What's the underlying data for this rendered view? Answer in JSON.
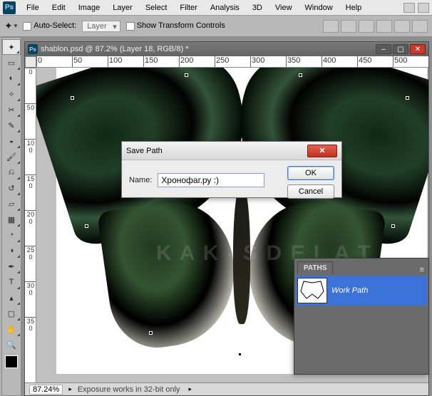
{
  "menu": {
    "items": [
      "File",
      "Edit",
      "Image",
      "Layer",
      "Select",
      "Filter",
      "Analysis",
      "3D",
      "View",
      "Window",
      "Help"
    ]
  },
  "options": {
    "auto_select_label": "Auto-Select:",
    "auto_select_value": "Layer",
    "show_transform_label": "Show Transform Controls"
  },
  "document": {
    "title": "shablon.psd @ 87.2% (Layer 18, RGB/8) *"
  },
  "ruler": {
    "h": [
      "0",
      "50",
      "100",
      "150",
      "200",
      "250",
      "300",
      "350",
      "400",
      "450",
      "500"
    ],
    "v": [
      "0",
      "5 0",
      "1 0 0",
      "1 5 0",
      "2 0 0",
      "2 5 0",
      "3 0 0",
      "3 5 0"
    ]
  },
  "dialog": {
    "title": "Save Path",
    "name_label": "Name:",
    "name_value": "Хронофаг.ру :)",
    "ok": "OK",
    "cancel": "Cancel"
  },
  "paths_panel": {
    "tab": "PATHS",
    "item_name": "Work Path"
  },
  "statusbar": {
    "zoom": "87.24%",
    "message": "Exposure works in 32-bit only"
  },
  "watermark": "K A K - S D E L A T",
  "tools": [
    "move",
    "rect-marquee",
    "lasso",
    "magic-wand",
    "crop",
    "eyedropper",
    "spot-heal",
    "brush",
    "clone-stamp",
    "history-brush",
    "eraser",
    "gradient",
    "blur",
    "dodge",
    "pen",
    "type",
    "path-select",
    "rectangle",
    "hand",
    "zoom"
  ]
}
